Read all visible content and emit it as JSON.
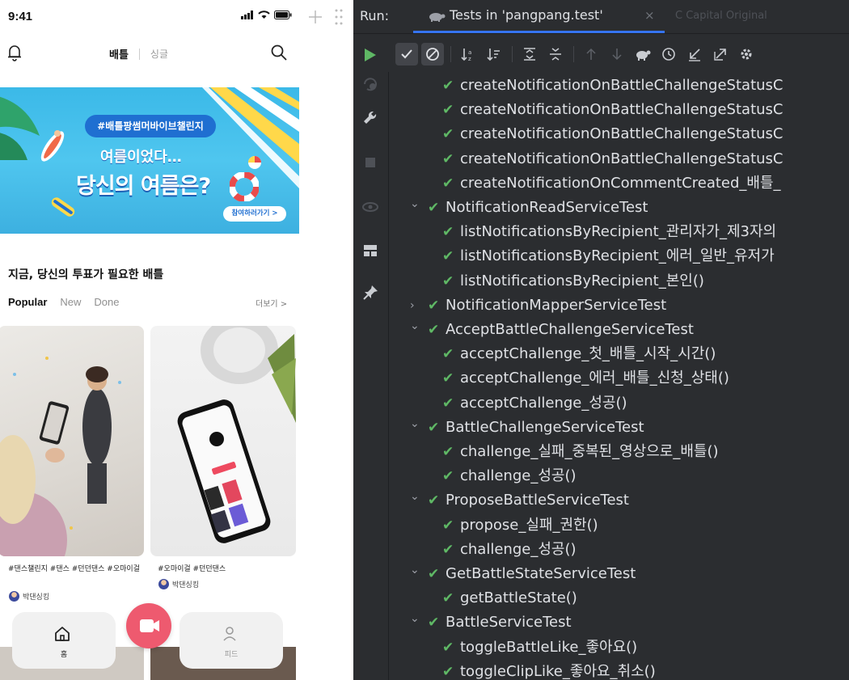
{
  "phone": {
    "status_time": "9:41",
    "nav": {
      "tab_battle": "배틀",
      "tab_single": "싱글"
    },
    "banner": {
      "tag": "#배틀팡썸머바이브챌린지",
      "line1": "여름이었다…",
      "line2": "당신의 여름은?",
      "cta": "참여하러가기 >"
    },
    "section_title": "지금, 당신의 투표가 필요한 배틀",
    "filters": [
      "Popular",
      "New",
      "Done"
    ],
    "more_label": "더보기 >",
    "cards": [
      {
        "caption": "#댄스챌린지 #댄스 #던던댄스 #오마이걸",
        "author": "박댄싱킹"
      },
      {
        "caption": "#오마이걸 #던던댄스",
        "author": "박댄싱킹"
      }
    ],
    "bottom_nav": {
      "home_label": "홈",
      "feed_label": "피드"
    }
  },
  "ide": {
    "run_label": "Run:",
    "run_tab": "Tests in 'pangpang.test'",
    "close_glyph": "×",
    "ghost_tabs": "C   Capital   Original",
    "tree": [
      {
        "indent": 2,
        "expand": "",
        "label": "createNotificationOnBattleChallengeStatusC"
      },
      {
        "indent": 2,
        "expand": "",
        "label": "createNotificationOnBattleChallengeStatusC"
      },
      {
        "indent": 2,
        "expand": "",
        "label": "createNotificationOnBattleChallengeStatusC"
      },
      {
        "indent": 2,
        "expand": "",
        "label": "createNotificationOnBattleChallengeStatusC"
      },
      {
        "indent": 2,
        "expand": "",
        "label": "createNotificationOnCommentCreated_배틀_"
      },
      {
        "indent": 1,
        "expand": "v",
        "label": "NotificationReadServiceTest"
      },
      {
        "indent": 2,
        "expand": "",
        "label": "listNotificationsByRecipient_관리자가_제3자의"
      },
      {
        "indent": 2,
        "expand": "",
        "label": "listNotificationsByRecipient_에러_일반_유저가"
      },
      {
        "indent": 2,
        "expand": "",
        "label": "listNotificationsByRecipient_본인()"
      },
      {
        "indent": 1,
        "expand": ">",
        "label": "NotificationMapperServiceTest"
      },
      {
        "indent": 1,
        "expand": "v",
        "label": "AcceptBattleChallengeServiceTest"
      },
      {
        "indent": 2,
        "expand": "",
        "label": "acceptChallenge_첫_배틀_시작_시간()"
      },
      {
        "indent": 2,
        "expand": "",
        "label": "acceptChallenge_에러_배틀_신청_상태()"
      },
      {
        "indent": 2,
        "expand": "",
        "label": "acceptChallenge_성공()"
      },
      {
        "indent": 1,
        "expand": "v",
        "label": "BattleChallengeServiceTest"
      },
      {
        "indent": 2,
        "expand": "",
        "label": "challenge_실패_중복된_영상으로_배틀()"
      },
      {
        "indent": 2,
        "expand": "",
        "label": "challenge_성공()"
      },
      {
        "indent": 1,
        "expand": "v",
        "label": "ProposeBattleServiceTest"
      },
      {
        "indent": 2,
        "expand": "",
        "label": "propose_실패_권한()"
      },
      {
        "indent": 2,
        "expand": "",
        "label": "challenge_성공()"
      },
      {
        "indent": 1,
        "expand": "v",
        "label": "GetBattleStateServiceTest"
      },
      {
        "indent": 2,
        "expand": "",
        "label": "getBattleState()"
      },
      {
        "indent": 1,
        "expand": "v",
        "label": "BattleServiceTest"
      },
      {
        "indent": 2,
        "expand": "",
        "label": "toggleBattleLike_좋아요()"
      },
      {
        "indent": 2,
        "expand": "",
        "label": "toggleClipLike_좋아요_취소()"
      }
    ]
  },
  "colors": {
    "ide_bg": "#2b2d30",
    "pass_green": "#5fb865",
    "accent_blue": "#3574f0",
    "record_pink": "#ee5a6f",
    "banner_blue": "#3bb9e8"
  }
}
